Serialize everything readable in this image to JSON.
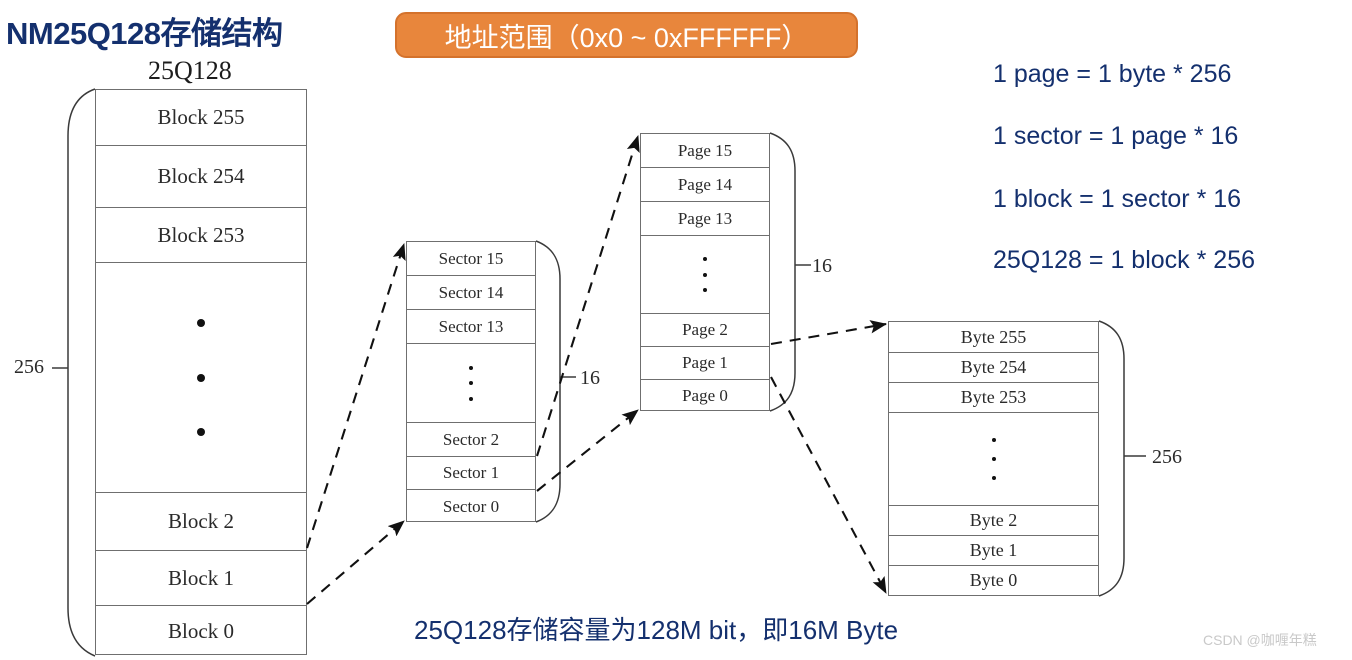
{
  "title": "NM25Q128存储结构",
  "banner": {
    "text": "地址范围（0x0 ~ 0xFFFFFF）",
    "bg": "#e8863c",
    "border": "#d4722c",
    "fg": "#ffffff"
  },
  "accent_color": "#14306e",
  "columns": {
    "blocks": {
      "heading": "25Q128",
      "count_label": "256",
      "rows": [
        "Block 255",
        "Block 254",
        "Block 253",
        "",
        "Block 2",
        "Block 1",
        "Block 0"
      ]
    },
    "sectors": {
      "count_label": "16",
      "rows": [
        "Sector 15",
        "Sector 14",
        "Sector 13",
        "",
        "Sector 2",
        "Sector 1",
        "Sector 0"
      ]
    },
    "pages": {
      "count_label": "16",
      "rows": [
        "Page 15",
        "Page 14",
        "Page 13",
        "",
        "Page 2",
        "Page 1",
        "Page 0"
      ]
    },
    "bytes": {
      "count_label": "256",
      "rows": [
        "Byte 255",
        "Byte 254",
        "Byte 253",
        "",
        "Byte 2",
        "Byte 1",
        "Byte 0"
      ]
    }
  },
  "equations": [
    "1 page = 1 byte * 256",
    "1 sector = 1 page * 16",
    "1 block = 1 sector * 16",
    "25Q128 = 1 block * 256"
  ],
  "caption": "25Q128存储容量为128M bit，即16M Byte",
  "watermark": "CSDN @咖喱年糕"
}
